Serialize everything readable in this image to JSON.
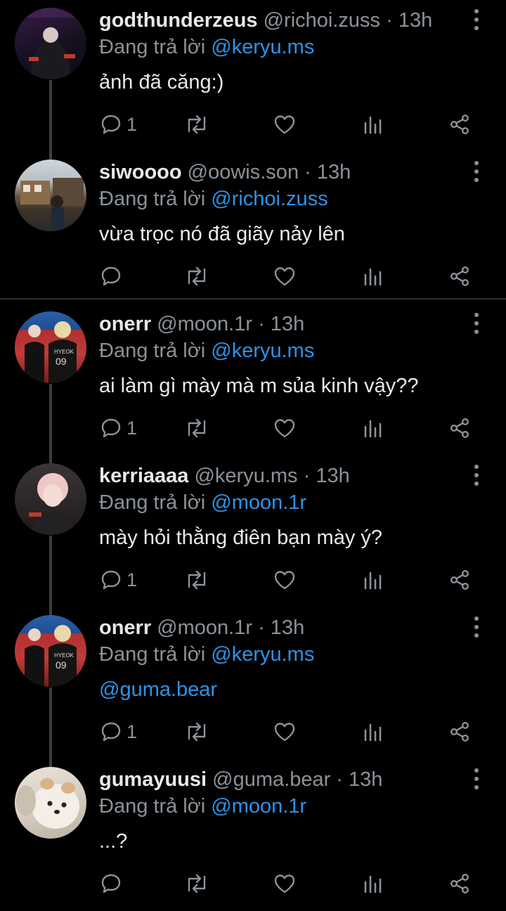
{
  "reply_prefix": "Đang trả lời",
  "colors": {
    "background": "#000000",
    "mention": "#2e93e6",
    "muted": "#8b9299",
    "text": "#e7e9ea"
  },
  "tweets": [
    {
      "name": "godthunderzeus",
      "handle": "@richoi.zuss",
      "time": "· 13h",
      "reply_to": "@keryu.ms",
      "text": "ảnh đã căng:)",
      "reply_count": "1",
      "text_is_mention": false
    },
    {
      "name": "siwoooo",
      "handle": "@oowis.son",
      "time": "· 13h",
      "reply_to": "@richoi.zuss",
      "text": "vừa trọc nó đã giãy nảy lên",
      "reply_count": "",
      "text_is_mention": false
    },
    {
      "name": "onerr",
      "handle": "@moon.1r",
      "time": "· 13h",
      "reply_to": "@keryu.ms",
      "text": "ai làm gì mày mà m sủa kinh vậy??",
      "reply_count": "1",
      "text_is_mention": false
    },
    {
      "name": "kerriaaaa",
      "handle": "@keryu.ms",
      "time": "· 13h",
      "reply_to": "@moon.1r",
      "text": "mày hỏi thằng điên bạn mày ý?",
      "reply_count": "1",
      "text_is_mention": false
    },
    {
      "name": "onerr",
      "handle": "@moon.1r",
      "time": "· 13h",
      "reply_to": "@keryu.ms",
      "text": "@guma.bear",
      "reply_count": "1",
      "text_is_mention": true
    },
    {
      "name": "gumayuusi",
      "handle": "@guma.bear",
      "time": "· 13h",
      "reply_to": "@moon.1r",
      "text": "...?",
      "reply_count": "",
      "text_is_mention": false
    }
  ],
  "icons": [
    "reply-icon",
    "retweet-icon",
    "like-icon",
    "views-icon",
    "share-icon",
    "more-icon"
  ]
}
